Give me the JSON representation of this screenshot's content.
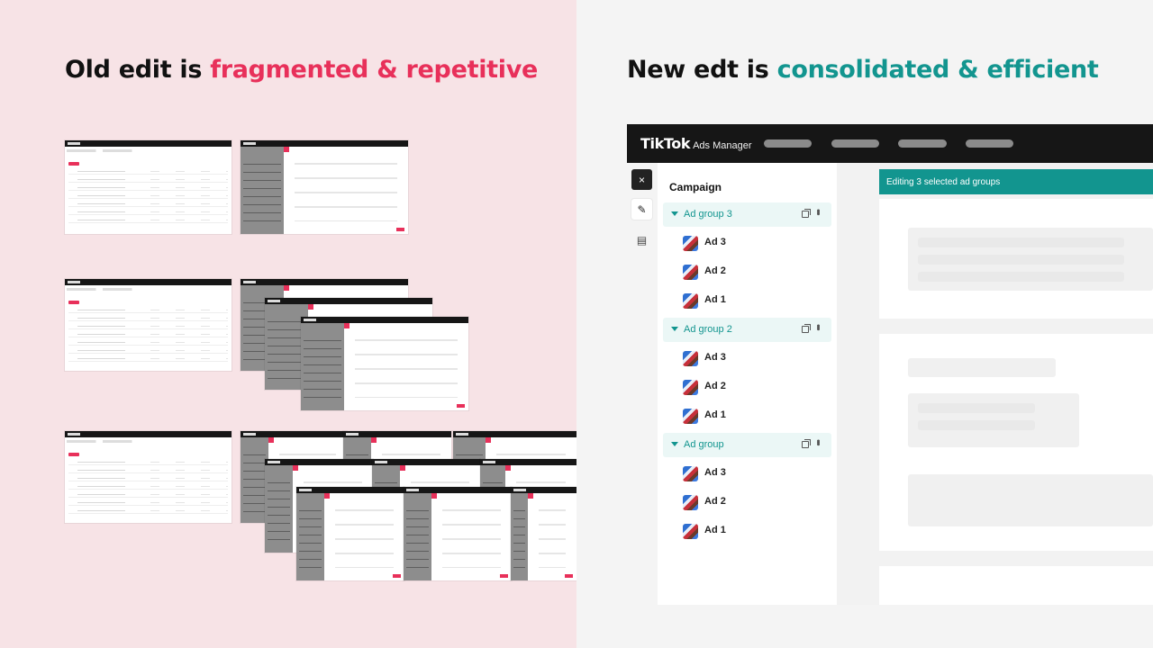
{
  "left": {
    "headline_prefix": "Old edit is ",
    "headline_accent": "fragmented & repetitive",
    "accent_color": "#e8305a",
    "background": "#f7e3e6"
  },
  "right": {
    "headline_prefix": "New edt is ",
    "headline_accent": "consolidated & efficient",
    "accent_color": "#12958f",
    "background": "#f4f4f4"
  },
  "app": {
    "brand_logo": "TikTok",
    "brand_sub": "Ads Manager",
    "rail": {
      "close_icon": "×",
      "edit_icon": "✎",
      "doc_icon": "▤"
    },
    "tree": {
      "title": "Campaign",
      "groups": [
        {
          "label": "Ad group 3",
          "ads": [
            "Ad 3",
            "Ad 2",
            "Ad 1"
          ]
        },
        {
          "label": "Ad group 2",
          "ads": [
            "Ad 3",
            "Ad 2",
            "Ad 1"
          ]
        },
        {
          "label": "Ad group",
          "ads": [
            "Ad 3",
            "Ad 2",
            "Ad 1"
          ]
        }
      ],
      "more_glyph": "•••"
    },
    "banner_text": "Editing 3 selected ad groups",
    "banner_color": "#12958f"
  }
}
